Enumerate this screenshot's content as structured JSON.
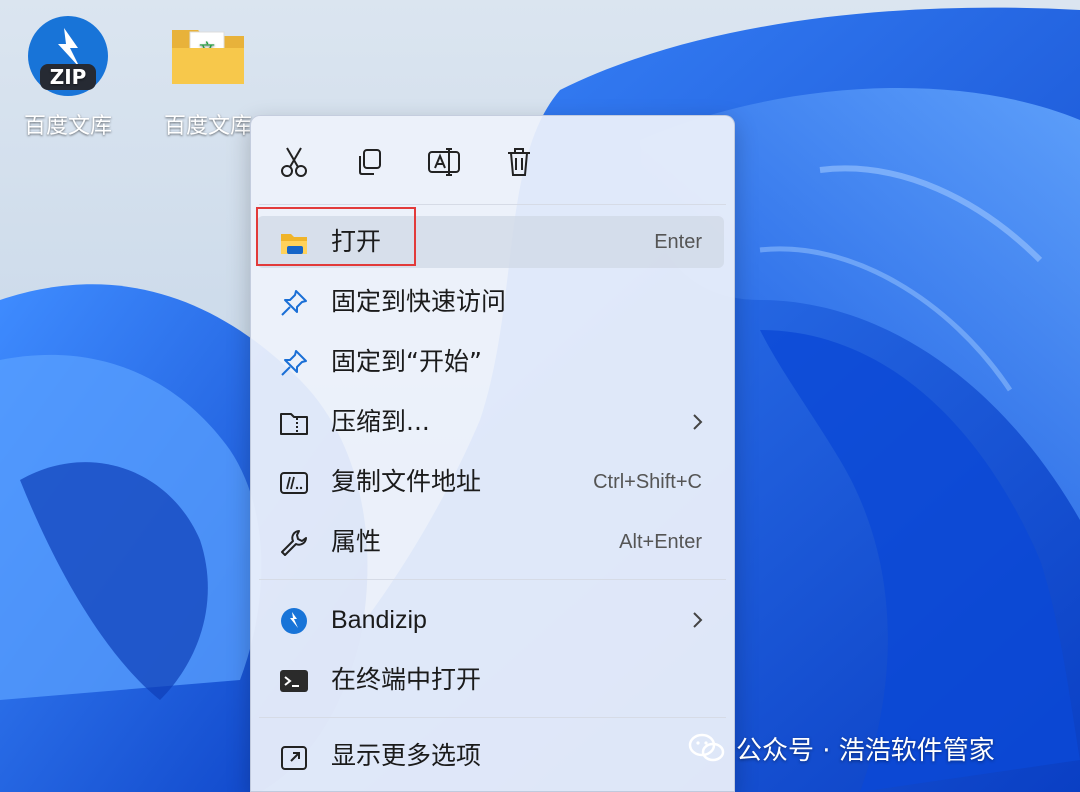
{
  "desktop": {
    "icons": [
      {
        "label": "百度文库",
        "badge": "ZIP",
        "icon": "bandizip-zip-icon"
      },
      {
        "label": "百度文库",
        "badge": "文",
        "icon": "folder-icon"
      }
    ]
  },
  "context_menu": {
    "toolbar": [
      {
        "icon": "scissors-icon",
        "action": "cut"
      },
      {
        "icon": "copy-icon",
        "action": "copy"
      },
      {
        "icon": "rename-icon",
        "action": "rename"
      },
      {
        "icon": "trash-icon",
        "action": "delete"
      }
    ],
    "items": [
      {
        "label": "打开",
        "shortcut": "Enter",
        "icon": "folder-open-icon"
      },
      {
        "label": "固定到快速访问",
        "shortcut": "",
        "icon": "pin-icon"
      },
      {
        "label": "固定到“开始”",
        "shortcut": "",
        "icon": "pin-icon"
      },
      {
        "label": "压缩到...",
        "shortcut": "",
        "icon": "zip-folder-icon",
        "submenu": true
      },
      {
        "label": "复制文件地址",
        "shortcut": "Ctrl+Shift+C",
        "icon": "path-icon"
      },
      {
        "label": "属性",
        "shortcut": "Alt+Enter",
        "icon": "wrench-icon"
      },
      {
        "label": "Bandizip",
        "shortcut": "",
        "icon": "bandizip-icon",
        "submenu": true
      },
      {
        "label": "在终端中打开",
        "shortcut": "",
        "icon": "terminal-icon"
      },
      {
        "label": "显示更多选项",
        "shortcut": "",
        "icon": "more-options-icon"
      }
    ]
  },
  "watermark": {
    "text": "公众号 · 浩浩软件管家"
  },
  "colors": {
    "accent": "#0a6cd9",
    "highlight_border": "#e23a3a",
    "wallpaper_blue": "#1565e8"
  }
}
